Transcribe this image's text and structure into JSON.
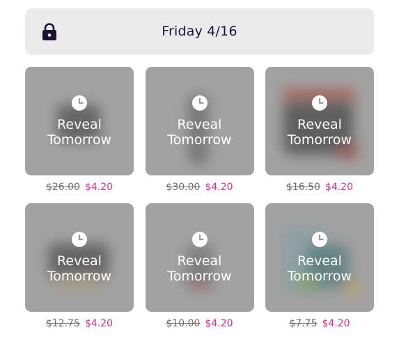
{
  "header": {
    "title": "Friday 4/16",
    "lock_icon": "lock-icon",
    "background_color": "#ecebec",
    "text_color": "#1c1233"
  },
  "colors": {
    "sale_price": "#e0298f",
    "old_price": "#6e6e6e",
    "tile_background": "#a6a6a6"
  },
  "products": [
    {
      "label": "Reveal\nTomorrow",
      "icon": "clock-icon",
      "old_price": "$26.00",
      "new_price": "$4.20"
    },
    {
      "label": "Reveal\nTomorrow",
      "icon": "clock-icon",
      "old_price": "$30.00",
      "new_price": "$4.20"
    },
    {
      "label": "Reveal\nTomorrow",
      "icon": "clock-icon",
      "old_price": "$16.50",
      "new_price": "$4.20"
    },
    {
      "label": "Reveal\nTomorrow",
      "icon": "clock-icon",
      "old_price": "$12.75",
      "new_price": "$4.20"
    },
    {
      "label": "Reveal\nTomorrow",
      "icon": "clock-icon",
      "old_price": "$10.00",
      "new_price": "$4.20"
    },
    {
      "label": "Reveal\nTomorrow",
      "icon": "clock-icon",
      "old_price": "$7.75",
      "new_price": "$4.20"
    }
  ]
}
